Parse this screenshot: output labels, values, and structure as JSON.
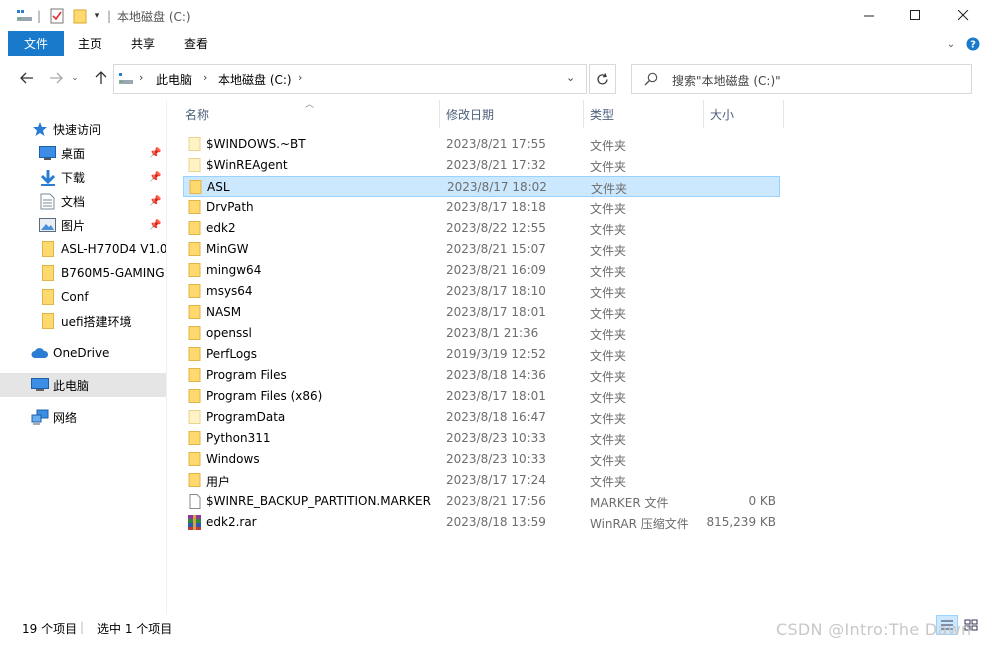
{
  "window": {
    "title": "本地磁盘 (C:)",
    "accent": "#1979ca"
  },
  "ribbon": {
    "tabs": [
      "文件",
      "主页",
      "共享",
      "查看"
    ]
  },
  "address": {
    "crumbs": [
      "此电脑",
      "本地磁盘 (C:)"
    ]
  },
  "search": {
    "placeholder": "搜索\"本地磁盘 (C:)\""
  },
  "sidebar": {
    "quick_access": "快速访问",
    "items": [
      {
        "label": "桌面",
        "pinned": true,
        "icon": "desktop-icon"
      },
      {
        "label": "下载",
        "pinned": true,
        "icon": "download-icon"
      },
      {
        "label": "文档",
        "pinned": true,
        "icon": "documents-icon"
      },
      {
        "label": "图片",
        "pinned": true,
        "icon": "pictures-icon"
      },
      {
        "label": "ASL-H770D4 V1.0",
        "pinned": false,
        "icon": "folder-icon"
      },
      {
        "label": "B760M5-GAMING",
        "pinned": false,
        "icon": "folder-icon"
      },
      {
        "label": "Conf",
        "pinned": false,
        "icon": "folder-icon"
      },
      {
        "label": "uefi搭建环境",
        "pinned": false,
        "icon": "folder-icon"
      }
    ],
    "onedrive": "OneDrive",
    "this_pc": "此电脑",
    "network": "网络"
  },
  "columns": {
    "name": "名称",
    "date": "修改日期",
    "type": "类型",
    "size": "大小"
  },
  "files": [
    {
      "name": "$WINDOWS.~BT",
      "date": "2023/8/21 17:55",
      "type": "文件夹",
      "size": "",
      "kind": "folder-light"
    },
    {
      "name": "$WinREAgent",
      "date": "2023/8/21 17:32",
      "type": "文件夹",
      "size": "",
      "kind": "folder-light"
    },
    {
      "name": "ASL",
      "date": "2023/8/17 18:02",
      "type": "文件夹",
      "size": "",
      "kind": "folder"
    },
    {
      "name": "DrvPath",
      "date": "2023/8/17 18:18",
      "type": "文件夹",
      "size": "",
      "kind": "folder"
    },
    {
      "name": "edk2",
      "date": "2023/8/22 12:55",
      "type": "文件夹",
      "size": "",
      "kind": "folder"
    },
    {
      "name": "MinGW",
      "date": "2023/8/21 15:07",
      "type": "文件夹",
      "size": "",
      "kind": "folder"
    },
    {
      "name": "mingw64",
      "date": "2023/8/21 16:09",
      "type": "文件夹",
      "size": "",
      "kind": "folder"
    },
    {
      "name": "msys64",
      "date": "2023/8/17 18:10",
      "type": "文件夹",
      "size": "",
      "kind": "folder"
    },
    {
      "name": "NASM",
      "date": "2023/8/17 18:01",
      "type": "文件夹",
      "size": "",
      "kind": "folder"
    },
    {
      "name": "openssl",
      "date": "2023/8/1 21:36",
      "type": "文件夹",
      "size": "",
      "kind": "folder"
    },
    {
      "name": "PerfLogs",
      "date": "2019/3/19 12:52",
      "type": "文件夹",
      "size": "",
      "kind": "folder"
    },
    {
      "name": "Program Files",
      "date": "2023/8/18 14:36",
      "type": "文件夹",
      "size": "",
      "kind": "folder"
    },
    {
      "name": "Program Files (x86)",
      "date": "2023/8/17 18:01",
      "type": "文件夹",
      "size": "",
      "kind": "folder"
    },
    {
      "name": "ProgramData",
      "date": "2023/8/18 16:47",
      "type": "文件夹",
      "size": "",
      "kind": "folder-light"
    },
    {
      "name": "Python311",
      "date": "2023/8/23 10:33",
      "type": "文件夹",
      "size": "",
      "kind": "folder"
    },
    {
      "name": "Windows",
      "date": "2023/8/23 10:33",
      "type": "文件夹",
      "size": "",
      "kind": "folder"
    },
    {
      "name": "用户",
      "date": "2023/8/17 17:24",
      "type": "文件夹",
      "size": "",
      "kind": "folder"
    },
    {
      "name": "$WINRE_BACKUP_PARTITION.MARKER",
      "date": "2023/8/21 17:56",
      "type": "MARKER 文件",
      "size": "0 KB",
      "kind": "file"
    },
    {
      "name": "edk2.rar",
      "date": "2023/8/18 13:59",
      "type": "WinRAR 压缩文件",
      "size": "815,239 KB",
      "kind": "rar"
    }
  ],
  "selected_index": 2,
  "status": {
    "count": "19 个项目",
    "selected": "选中 1 个项目"
  },
  "watermark": "CSDN @Intro:The Dawn"
}
